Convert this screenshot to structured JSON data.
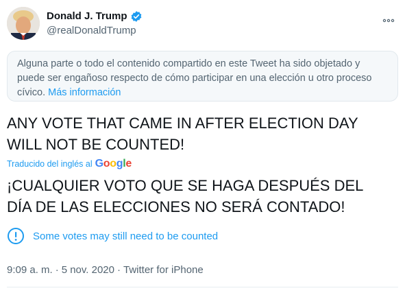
{
  "author": {
    "display_name": "Donald J. Trump",
    "handle": "@realDonaldTrump",
    "verified": true
  },
  "notice": {
    "text": "Alguna parte o todo el contenido compartido en este Tweet ha sido objetado y puede ser engañoso respecto de cómo participar en una elección u otro proceso cívico.",
    "link": "Más información"
  },
  "tweet": {
    "text_line1": "ANY VOTE THAT CAME IN AFTER ELECTION DAY",
    "text_line2": "WILL NOT BE COUNTED!"
  },
  "translation": {
    "label": "Traducido del inglés al",
    "provider": "Google",
    "text_line1": "¡CUALQUIER VOTO QUE SE HAGA DESPUÉS DEL",
    "text_line2": "DÍA DE LAS ELECCIONES NO SERÁ CONTADO!"
  },
  "label": {
    "text": "Some votes may still need to be counted",
    "icon": "info-icon"
  },
  "meta": {
    "time": "9:09 a. m.",
    "sep1": "·",
    "date": "5 nov. 2020",
    "sep2": "·",
    "source": "Twitter for iPhone"
  },
  "colors": {
    "accent": "#1d9bf0",
    "text": "#0f1419",
    "secondary": "#536471",
    "notice_bg": "#f5f8fa"
  }
}
